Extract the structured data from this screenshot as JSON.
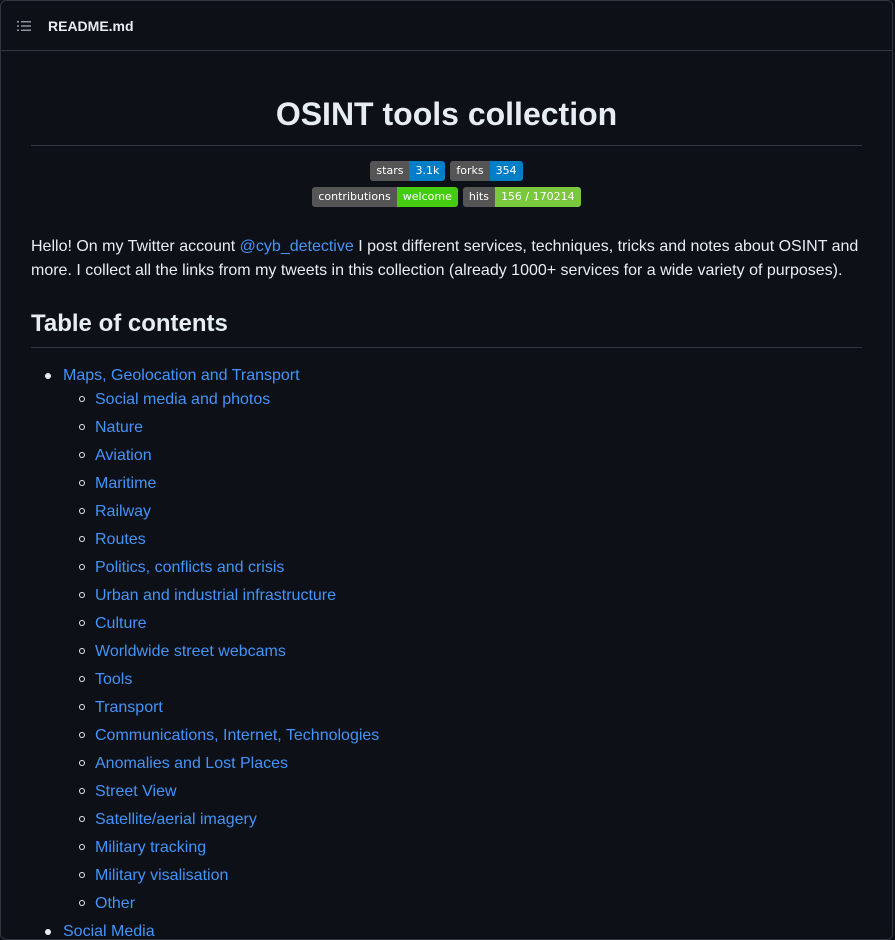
{
  "header": {
    "file_name": "README.md",
    "icon": "list-icon"
  },
  "title": "OSINT tools collection",
  "badges": [
    [
      {
        "label": "stars",
        "value": "3.1k",
        "color": "#007ec6"
      },
      {
        "label": "forks",
        "value": "354",
        "color": "#007ec6"
      }
    ],
    [
      {
        "label": "contributions",
        "value": "welcome",
        "color": "#4c1"
      },
      {
        "label": "hits",
        "value": "156 / 170214",
        "color": "#79c83d"
      }
    ]
  ],
  "intro": {
    "before": "Hello! On my Twitter account ",
    "link": "@cyb_detective",
    "after": " I post different services, techniques, tricks and notes about OSINT and more. I collect all the links from my tweets in this collection (already 1000+ services for a wide variety of purposes)."
  },
  "toc": {
    "title": "Table of contents",
    "sections": [
      {
        "label": "Maps, Geolocation and Transport",
        "items": [
          "Social media and photos",
          "Nature",
          "Aviation",
          "Maritime",
          "Railway",
          "Routes",
          "Politics, conflicts and crisis",
          "Urban and industrial infrastructure",
          "Culture",
          "Worldwide street webcams",
          "Tools",
          "Transport",
          "Communications, Internet, Technologies",
          "Anomalies and Lost Places",
          "Street View",
          "Satellite/aerial imagery",
          "Military tracking",
          "Military visalisation",
          "Other"
        ]
      },
      {
        "label": "Social Media",
        "items": []
      }
    ]
  },
  "colors": {
    "background": "#0d1117",
    "text": "#e6edf3",
    "link": "#4493f8",
    "border": "#30363d"
  }
}
